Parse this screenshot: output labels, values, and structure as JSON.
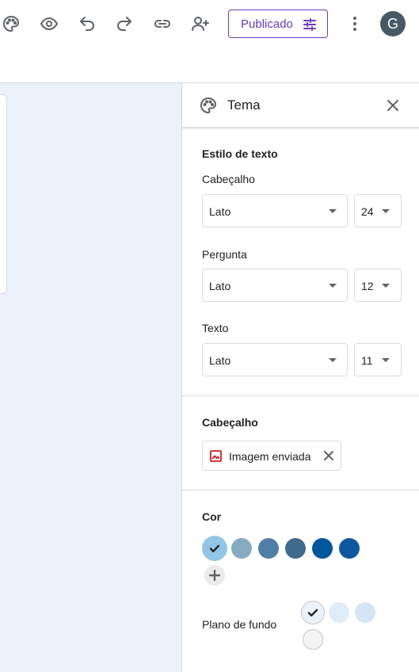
{
  "toolbar": {
    "publish_label": "Publicado",
    "avatar_initial": "G",
    "icons": [
      "palette-icon",
      "eye-icon",
      "undo-icon",
      "redo-icon",
      "link-icon",
      "add-person-icon",
      "tune-icon",
      "more-vert-icon"
    ]
  },
  "panel": {
    "title": "Tema",
    "text_style": {
      "section_title": "Estilo de texto",
      "header": {
        "label": "Cabeçalho",
        "font": "Lato",
        "size": "24"
      },
      "question": {
        "label": "Pergunta",
        "font": "Lato",
        "size": "12"
      },
      "text": {
        "label": "Texto",
        "font": "Lato",
        "size": "11"
      }
    },
    "header_image": {
      "section_title": "Cabeçalho",
      "chip_label": "Imagem enviada"
    },
    "color": {
      "section_title": "Cor",
      "swatches": [
        "#92c5e6",
        "#86abc1",
        "#4f7ea6",
        "#3f6a8c",
        "#02569e",
        "#0e58a0"
      ],
      "selected_index": 0
    },
    "background": {
      "label": "Plano de fundo",
      "swatches": [
        "#eaf2fb",
        "#dfedf8",
        "#d4e6f4",
        "#f4f4f4"
      ],
      "selected_index": 0
    }
  }
}
